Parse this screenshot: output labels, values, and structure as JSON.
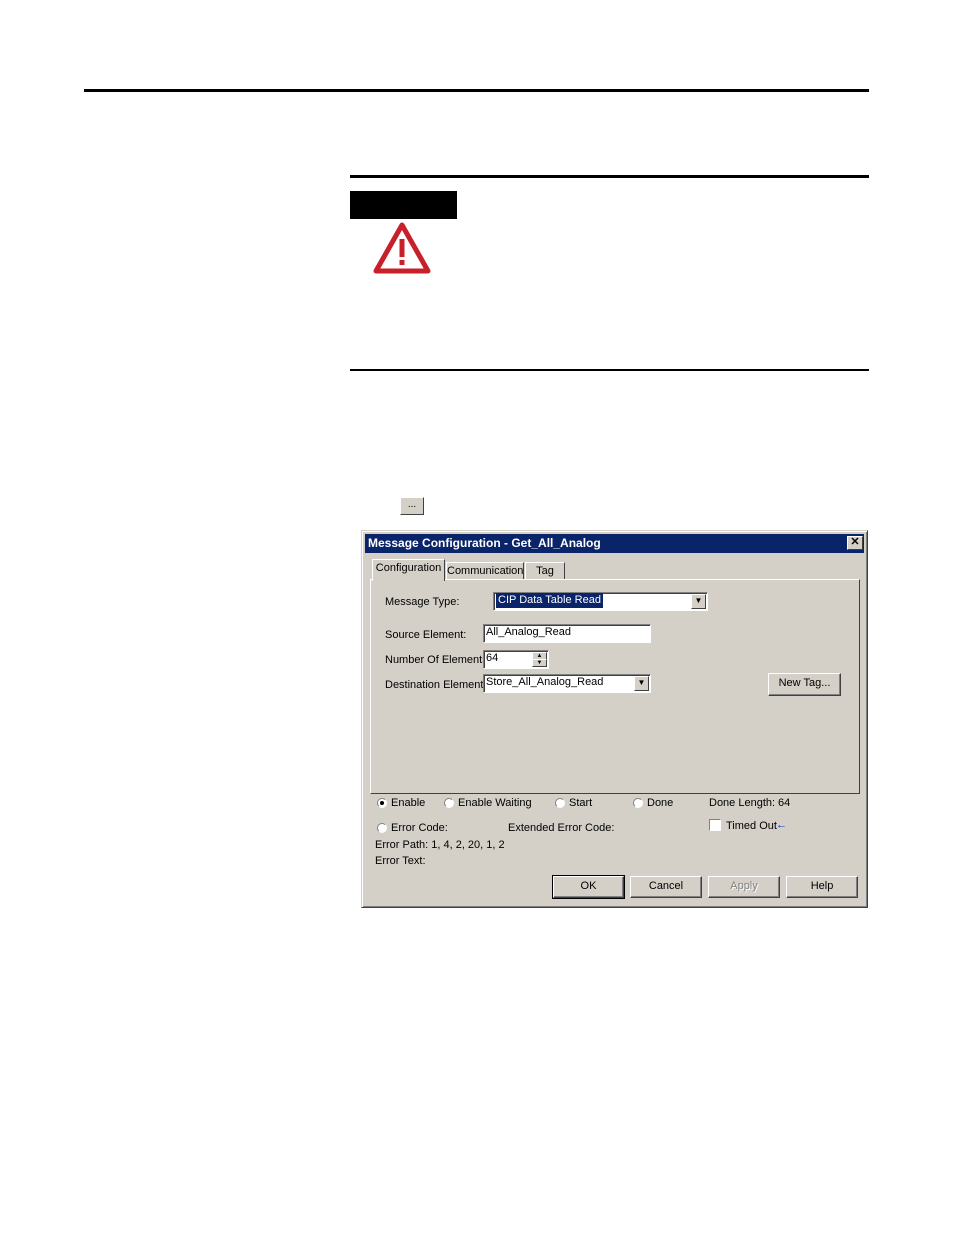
{
  "ellipsis_button": {
    "label": "..."
  },
  "dialog": {
    "title": "Message Configuration - Get_All_Analog",
    "close_glyph": "✕",
    "tabs": [
      {
        "label": "Configuration",
        "active": true
      },
      {
        "label": "Communication",
        "active": false
      },
      {
        "label": "Tag",
        "active": false
      }
    ],
    "fields": {
      "message_type": {
        "label": "Message Type:",
        "value": "CIP Data Table Read"
      },
      "source_element": {
        "label": "Source Element:",
        "value": "All_Analog_Read"
      },
      "number_of_elements": {
        "label": "Number Of Elements:",
        "value": "64"
      },
      "destination_element": {
        "label": "Destination Element:",
        "value": "Store_All_Analog_Read"
      }
    },
    "new_tag_button": "New Tag...",
    "status": {
      "enable": "Enable",
      "enable_waiting": "Enable Waiting",
      "start": "Start",
      "done": "Done",
      "done_length_label": "Done Length:",
      "done_length_value": "64",
      "error_code": "Error Code:",
      "extended_error_code": "Extended Error Code:",
      "timed_out": "Timed Out",
      "error_path": "Error Path: 1, 4, 2, 20, 1, 2",
      "error_text": "Error Text:"
    },
    "buttons": {
      "ok": "OK",
      "cancel": "Cancel",
      "apply": "Apply",
      "help": "Help"
    }
  },
  "colors": {
    "warning_red": "#c8202a",
    "titlebar": "#0a246a",
    "dialog_face": "#d4d0c8",
    "highlight": "#0a246a"
  },
  "icons": [
    "warning-icon",
    "dropdown-arrow-icon",
    "spinner-icon",
    "close-icon",
    "arrow-left-icon"
  ]
}
